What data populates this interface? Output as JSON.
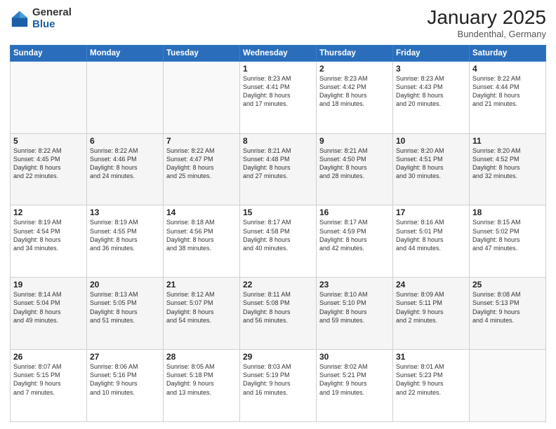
{
  "header": {
    "logo_general": "General",
    "logo_blue": "Blue",
    "title": "January 2025",
    "location": "Bundenthal, Germany"
  },
  "weekdays": [
    "Sunday",
    "Monday",
    "Tuesday",
    "Wednesday",
    "Thursday",
    "Friday",
    "Saturday"
  ],
  "weeks": [
    [
      {
        "day": "",
        "info": ""
      },
      {
        "day": "",
        "info": ""
      },
      {
        "day": "",
        "info": ""
      },
      {
        "day": "1",
        "info": "Sunrise: 8:23 AM\nSunset: 4:41 PM\nDaylight: 8 hours\nand 17 minutes."
      },
      {
        "day": "2",
        "info": "Sunrise: 8:23 AM\nSunset: 4:42 PM\nDaylight: 8 hours\nand 18 minutes."
      },
      {
        "day": "3",
        "info": "Sunrise: 8:23 AM\nSunset: 4:43 PM\nDaylight: 8 hours\nand 20 minutes."
      },
      {
        "day": "4",
        "info": "Sunrise: 8:22 AM\nSunset: 4:44 PM\nDaylight: 8 hours\nand 21 minutes."
      }
    ],
    [
      {
        "day": "5",
        "info": "Sunrise: 8:22 AM\nSunset: 4:45 PM\nDaylight: 8 hours\nand 22 minutes."
      },
      {
        "day": "6",
        "info": "Sunrise: 8:22 AM\nSunset: 4:46 PM\nDaylight: 8 hours\nand 24 minutes."
      },
      {
        "day": "7",
        "info": "Sunrise: 8:22 AM\nSunset: 4:47 PM\nDaylight: 8 hours\nand 25 minutes."
      },
      {
        "day": "8",
        "info": "Sunrise: 8:21 AM\nSunset: 4:48 PM\nDaylight: 8 hours\nand 27 minutes."
      },
      {
        "day": "9",
        "info": "Sunrise: 8:21 AM\nSunset: 4:50 PM\nDaylight: 8 hours\nand 28 minutes."
      },
      {
        "day": "10",
        "info": "Sunrise: 8:20 AM\nSunset: 4:51 PM\nDaylight: 8 hours\nand 30 minutes."
      },
      {
        "day": "11",
        "info": "Sunrise: 8:20 AM\nSunset: 4:52 PM\nDaylight: 8 hours\nand 32 minutes."
      }
    ],
    [
      {
        "day": "12",
        "info": "Sunrise: 8:19 AM\nSunset: 4:54 PM\nDaylight: 8 hours\nand 34 minutes."
      },
      {
        "day": "13",
        "info": "Sunrise: 8:19 AM\nSunset: 4:55 PM\nDaylight: 8 hours\nand 36 minutes."
      },
      {
        "day": "14",
        "info": "Sunrise: 8:18 AM\nSunset: 4:56 PM\nDaylight: 8 hours\nand 38 minutes."
      },
      {
        "day": "15",
        "info": "Sunrise: 8:17 AM\nSunset: 4:58 PM\nDaylight: 8 hours\nand 40 minutes."
      },
      {
        "day": "16",
        "info": "Sunrise: 8:17 AM\nSunset: 4:59 PM\nDaylight: 8 hours\nand 42 minutes."
      },
      {
        "day": "17",
        "info": "Sunrise: 8:16 AM\nSunset: 5:01 PM\nDaylight: 8 hours\nand 44 minutes."
      },
      {
        "day": "18",
        "info": "Sunrise: 8:15 AM\nSunset: 5:02 PM\nDaylight: 8 hours\nand 47 minutes."
      }
    ],
    [
      {
        "day": "19",
        "info": "Sunrise: 8:14 AM\nSunset: 5:04 PM\nDaylight: 8 hours\nand 49 minutes."
      },
      {
        "day": "20",
        "info": "Sunrise: 8:13 AM\nSunset: 5:05 PM\nDaylight: 8 hours\nand 51 minutes."
      },
      {
        "day": "21",
        "info": "Sunrise: 8:12 AM\nSunset: 5:07 PM\nDaylight: 8 hours\nand 54 minutes."
      },
      {
        "day": "22",
        "info": "Sunrise: 8:11 AM\nSunset: 5:08 PM\nDaylight: 8 hours\nand 56 minutes."
      },
      {
        "day": "23",
        "info": "Sunrise: 8:10 AM\nSunset: 5:10 PM\nDaylight: 8 hours\nand 59 minutes."
      },
      {
        "day": "24",
        "info": "Sunrise: 8:09 AM\nSunset: 5:11 PM\nDaylight: 9 hours\nand 2 minutes."
      },
      {
        "day": "25",
        "info": "Sunrise: 8:08 AM\nSunset: 5:13 PM\nDaylight: 9 hours\nand 4 minutes."
      }
    ],
    [
      {
        "day": "26",
        "info": "Sunrise: 8:07 AM\nSunset: 5:15 PM\nDaylight: 9 hours\nand 7 minutes."
      },
      {
        "day": "27",
        "info": "Sunrise: 8:06 AM\nSunset: 5:16 PM\nDaylight: 9 hours\nand 10 minutes."
      },
      {
        "day": "28",
        "info": "Sunrise: 8:05 AM\nSunset: 5:18 PM\nDaylight: 9 hours\nand 13 minutes."
      },
      {
        "day": "29",
        "info": "Sunrise: 8:03 AM\nSunset: 5:19 PM\nDaylight: 9 hours\nand 16 minutes."
      },
      {
        "day": "30",
        "info": "Sunrise: 8:02 AM\nSunset: 5:21 PM\nDaylight: 9 hours\nand 19 minutes."
      },
      {
        "day": "31",
        "info": "Sunrise: 8:01 AM\nSunset: 5:23 PM\nDaylight: 9 hours\nand 22 minutes."
      },
      {
        "day": "",
        "info": ""
      }
    ]
  ]
}
